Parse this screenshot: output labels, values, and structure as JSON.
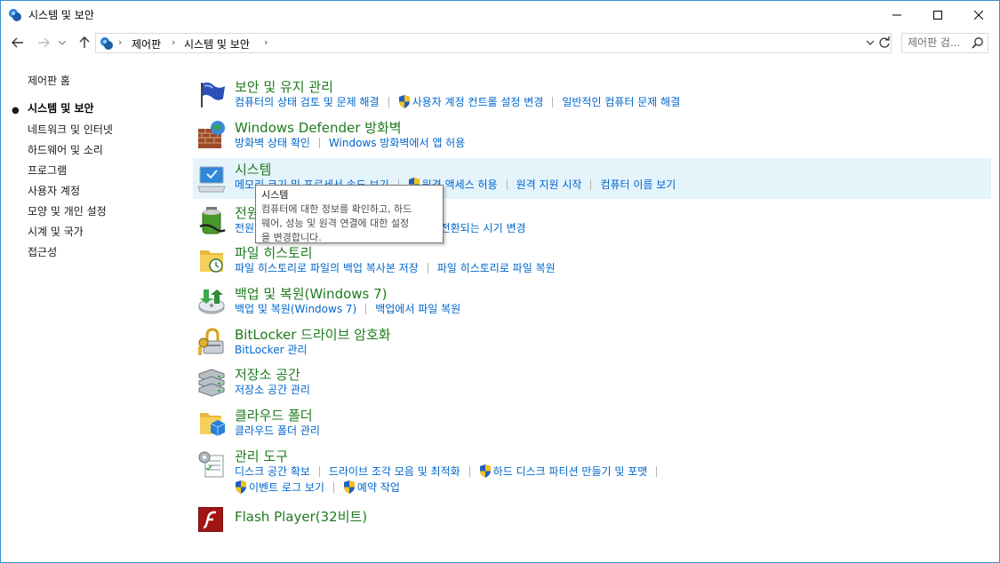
{
  "window": {
    "title": "시스템 및 보안"
  },
  "address": {
    "crumbs": [
      "제어판",
      "시스템 및 보안"
    ]
  },
  "search": {
    "placeholder": "제어판 검..."
  },
  "sidebar": {
    "items": [
      {
        "label": "제어판 홈",
        "active": false
      },
      {
        "label": "시스템 및 보안",
        "active": true
      },
      {
        "label": "네트워크 및 인터넷",
        "active": false
      },
      {
        "label": "하드웨어 및 소리",
        "active": false
      },
      {
        "label": "프로그램",
        "active": false
      },
      {
        "label": "사용자 계정",
        "active": false
      },
      {
        "label": "모양 및 개인 설정",
        "active": false
      },
      {
        "label": "시계 및 국가",
        "active": false
      },
      {
        "label": "접근성",
        "active": false
      }
    ]
  },
  "categories": [
    {
      "title": "보안 및 유지 관리",
      "icon": "flag-icon",
      "links": [
        {
          "label": "컴퓨터의 상태 검토 및 문제 해결",
          "shield": false
        },
        {
          "label": "사용자 계정 컨트롤 설정 변경",
          "shield": true
        },
        {
          "label": "일반적인 컴퓨터 문제 해결",
          "shield": false
        }
      ]
    },
    {
      "title": "Windows Defender 방화벽",
      "icon": "firewall-icon",
      "links": [
        {
          "label": "방화벽 상태 확인",
          "shield": false
        },
        {
          "label": "Windows 방화벽에서 앱 허용",
          "shield": false
        }
      ]
    },
    {
      "title": "시스템",
      "icon": "system-icon",
      "links": [
        {
          "label": "메모리 크기 및 프로세서 속도 보기",
          "shield": false
        },
        {
          "label": "원격 액세스 허용",
          "shield": true
        },
        {
          "label": "원격 지원 시작",
          "shield": false
        },
        {
          "label": "컴퓨터 이름 보기",
          "shield": false
        }
      ]
    },
    {
      "title": "전원 옵션",
      "icon": "power-icon",
      "links": [
        {
          "label": "전원 단추 동작 변경",
          "shield": false
        },
        {
          "label": "컴퓨터가 절전 모드로 전환되는 시기 변경",
          "shield": false
        }
      ]
    },
    {
      "title": "파일 히스토리",
      "icon": "file-history-icon",
      "links": [
        {
          "label": "파일 히스토리로 파일의 백업 복사본 저장",
          "shield": false
        },
        {
          "label": "파일 히스토리로 파일 복원",
          "shield": false
        }
      ]
    },
    {
      "title": "백업 및 복원(Windows 7)",
      "icon": "backup-icon",
      "links": [
        {
          "label": "백업 및 복원(Windows 7)",
          "shield": false
        },
        {
          "label": "백업에서 파일 복원",
          "shield": false
        }
      ]
    },
    {
      "title": "BitLocker 드라이브 암호화",
      "icon": "bitlocker-icon",
      "links": [
        {
          "label": "BitLocker 관리",
          "shield": false
        }
      ]
    },
    {
      "title": "저장소 공간",
      "icon": "storage-icon",
      "links": [
        {
          "label": "저장소 공간 관리",
          "shield": false
        }
      ]
    },
    {
      "title": "클라우드 폴더",
      "icon": "cloud-folder-icon",
      "links": [
        {
          "label": "클라우드 폴더 관리",
          "shield": false
        }
      ]
    },
    {
      "title": "관리 도구",
      "icon": "admin-tools-icon",
      "links": [
        {
          "label": "디스크 공간 확보",
          "shield": false
        },
        {
          "label": "드라이브 조각 모음 및 최적화",
          "shield": false
        },
        {
          "label": "하드 디스크 파티션 만들기 및 포맷",
          "shield": true
        }
      ],
      "links2": [
        {
          "label": "이벤트 로그 보기",
          "shield": true
        },
        {
          "label": "예약 작업",
          "shield": true
        }
      ]
    },
    {
      "title": "Flash Player(32비트)",
      "icon": "flash-icon",
      "links": []
    }
  ],
  "tooltip": {
    "title": "시스템",
    "line1": "컴퓨터에 대한 정보를 확인하고, 하드",
    "line2": "웨어, 성능 및 원격 연결에 대한 설정",
    "line3": "을 변경합니다."
  },
  "colors": {
    "category_title": "#1e7b1e",
    "link": "#0066cc",
    "hover_row": "#e5f3fb",
    "window_border": "#3b8fd0"
  }
}
